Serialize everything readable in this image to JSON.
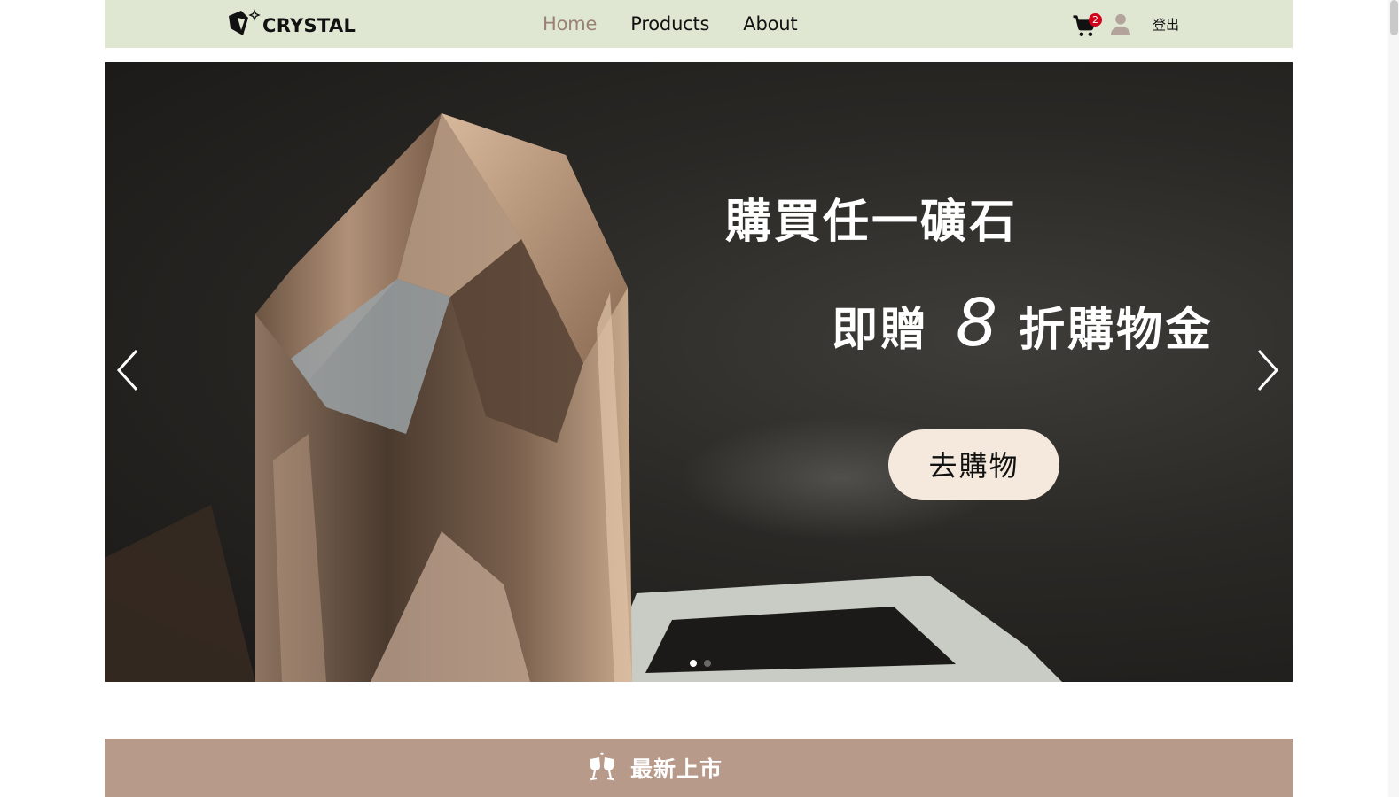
{
  "header": {
    "brand": {
      "name": "CRYSTAL",
      "icon": "crystal-logo-icon"
    },
    "nav": [
      {
        "label": "Home",
        "active": true
      },
      {
        "label": "Products",
        "active": false
      },
      {
        "label": "About",
        "active": false
      }
    ],
    "cart": {
      "icon": "cart-icon",
      "count": "2"
    },
    "user": {
      "icon": "user-icon"
    },
    "logout_label": "登出"
  },
  "hero": {
    "title": "購買任一礦石",
    "subtitle_pre": "即贈",
    "subtitle_number": "8",
    "subtitle_post": "折購物金",
    "cta_label": "去購物",
    "prev_icon": "chevron-left-icon",
    "next_icon": "chevron-right-icon",
    "slides": {
      "count": 2,
      "active_index": 0
    }
  },
  "section": {
    "icon": "cheers-icon",
    "title": "最新上市"
  },
  "colors": {
    "navbar_bg": "#dfe7d2",
    "nav_active": "#9a8175",
    "cta_bg": "#f4e9dc",
    "section_bg": "#b89a8a",
    "badge": "#d0021b"
  }
}
